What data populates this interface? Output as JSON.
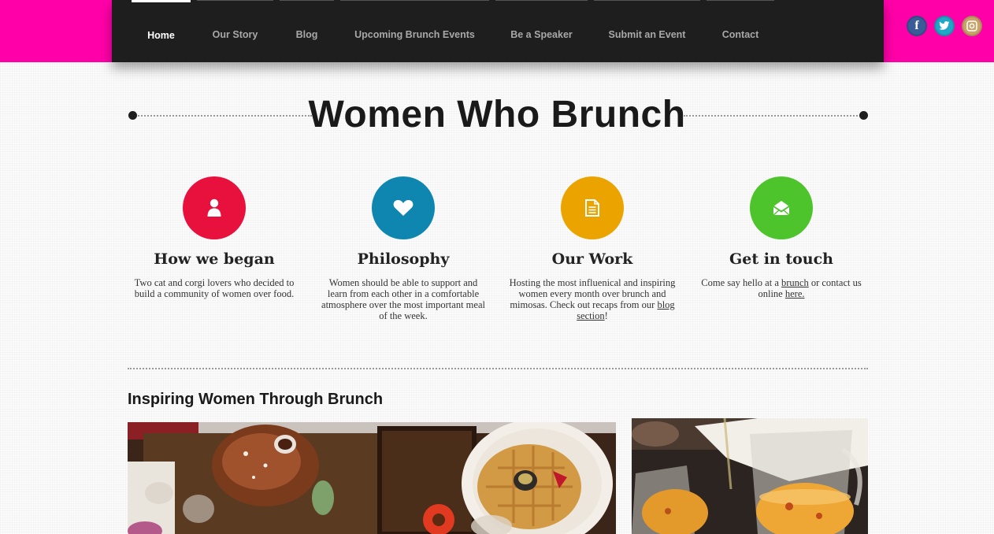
{
  "brand": {
    "accent": "#ff00a8",
    "nav_bg": "#1e1e1e"
  },
  "nav": {
    "items": [
      {
        "label": "Home"
      },
      {
        "label": "Our Story"
      },
      {
        "label": "Blog"
      },
      {
        "label": "Upcoming Brunch Events"
      },
      {
        "label": "Be a Speaker"
      },
      {
        "label": "Submit an Event"
      },
      {
        "label": "Contact"
      }
    ]
  },
  "social": {
    "facebook": {
      "glyph": "f",
      "icon": "facebook-icon"
    },
    "twitter": {
      "glyph": "t",
      "icon": "twitter-icon"
    },
    "instagram": {
      "glyph": "◎",
      "icon": "instagram-icon"
    }
  },
  "header": {
    "title": "Women Who Brunch"
  },
  "features": [
    {
      "icon": "user-icon",
      "color": "#e8103c",
      "heading": "How we began",
      "text": "Two cat and corgi lovers who decided to build a community of women over food."
    },
    {
      "icon": "heart-icon",
      "color": "#0f86b0",
      "heading": "Philosophy",
      "text": "Women should be able to support and learn from each other in a comfortable atmosphere over the most important meal of the week."
    },
    {
      "icon": "document-icon",
      "color": "#eba300",
      "heading": "Our Work",
      "text_before": "Hosting the most influenical and inspiring women every month over brunch and mimosas. Check out recaps from our ",
      "link": "blog section",
      "text_after": "!"
    },
    {
      "icon": "envelope-icon",
      "color": "#4ec42c",
      "heading": "Get in touch",
      "text_before": "Come say hello at a ",
      "link1": "brunch",
      "text_mid": " or contact us online ",
      "link2": "here."
    }
  ],
  "section": {
    "title": "Inspiring Women Through Brunch"
  }
}
